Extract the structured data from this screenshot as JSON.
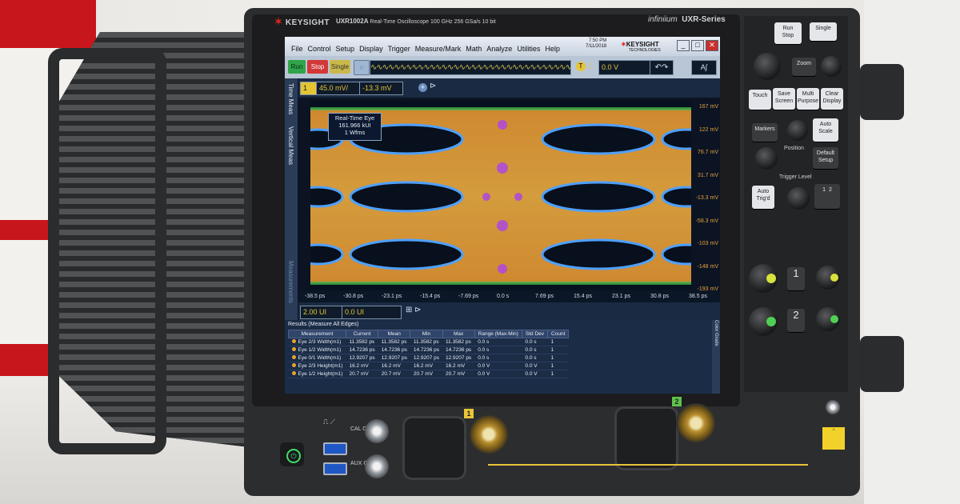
{
  "brand": {
    "logo_text": "KEYSIGHT",
    "model": "UXR1002A",
    "model_desc": "Real-Time Oscilloscope",
    "model_specs": "100 GHz   256 GSa/s   10 bit",
    "family": "infiniium",
    "series": "UXR-Series"
  },
  "menubar": {
    "items": [
      "File",
      "Control",
      "Setup",
      "Display",
      "Trigger",
      "Measure/Mark",
      "Math",
      "Analyze",
      "Utilities",
      "Help"
    ],
    "time": "7:50 PM",
    "date": "7/11/2018",
    "logo": "KEYSIGHT",
    "logo_sub": "TECHNOLOGIES"
  },
  "toolbar": {
    "run": "Run",
    "stop": "Stop",
    "single": "Single",
    "trigger_label": "T",
    "trigger_level": "0.0 V",
    "auto_label": "A"
  },
  "side_tabs": [
    "Time Meas",
    "Vertical Meas",
    "Measurements"
  ],
  "vertical": {
    "scale": "45.0 mV/",
    "offset": "-13.3 mV"
  },
  "eye_tooltip": {
    "title": "Real-Time Eye",
    "count": "161.966 kUI",
    "wfms": "1 Wfms"
  },
  "y_axis": [
    "167 mV",
    "122 mV",
    "76.7 mV",
    "31.7 mV",
    "-13.3 mV",
    "-58.3 mV",
    "-103 mV",
    "-148 mV",
    "-193 mV"
  ],
  "x_axis": [
    "-38.5 ps",
    "-30.8 ps",
    "-23.1 ps",
    "-15.4 ps",
    "-7.69 ps",
    "0.0 s",
    "7.69 ps",
    "15.4 ps",
    "23.1 ps",
    "30.8 ps",
    "38.5 ps"
  ],
  "marker": "m1",
  "horizontal": {
    "scale": "2.00 UI",
    "position": "0.0 UI"
  },
  "color_grade_tab": "Color Grade",
  "results": {
    "title": "Results (Measure All Edges)",
    "headers": [
      "Measurement",
      "Current",
      "Mean",
      "Min",
      "Max",
      "Range (Max-Min)",
      "Std Dev",
      "Count"
    ],
    "rows": [
      [
        "Eye 2/3 Width(m1)",
        "11.3582 ps",
        "11.3582 ps",
        "11.3582 ps",
        "11.3582 ps",
        "0.0 s",
        "0.0 s",
        "1"
      ],
      [
        "Eye 1/2 Width(m1)",
        "14.7236 ps",
        "14.7236 ps",
        "14.7236 ps",
        "14.7236 ps",
        "0.0 s",
        "0.0 s",
        "1"
      ],
      [
        "Eye 0/1 Width(m1)",
        "12.9207 ps",
        "12.9207 ps",
        "12.9207 ps",
        "12.9207 ps",
        "0.0 s",
        "0.0 s",
        "1"
      ],
      [
        "Eye 2/3 Height(m1)",
        "16.2 mV",
        "16.2 mV",
        "16.2 mV",
        "16.2 mV",
        "0.0 V",
        "0.0 V",
        "1"
      ],
      [
        "Eye 1/2 Height(m1)",
        "20.7 mV",
        "20.7 mV",
        "20.7 mV",
        "20.7 mV",
        "0.0 V",
        "0.0 V",
        "1"
      ]
    ]
  },
  "panel": {
    "run_stop": "Run\nStop",
    "single": "Single",
    "zoom": "Zoom",
    "touch": "Touch",
    "save_screen": "Save Screen",
    "multi_purpose": "Multi Purpose",
    "clear_display": "Clear Display",
    "markers": "Markers",
    "auto_scale": "Auto Scale",
    "position": "Position",
    "default_setup": "Default Setup",
    "trigger_level": "Trigger Level",
    "auto_trig": "Auto Trig'd",
    "ch1": "1",
    "ch2": "2"
  },
  "front": {
    "cal_out": "CAL OUT",
    "aux_out": "AUX OUT",
    "channel1": "1",
    "channel2": "2"
  },
  "colors": {
    "accent_yellow": "#e4c534",
    "screen_bg": "#0c1424",
    "run_green": "#2fa44a",
    "stop_red": "#d33838",
    "banner_red": "#c8161d"
  }
}
